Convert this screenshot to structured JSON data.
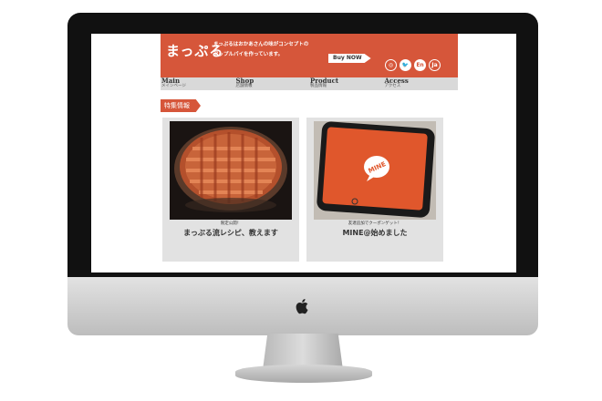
{
  "site": {
    "logo": "まっぷる",
    "tagline": "まっぷるはおかあさんの味がコンセプトの\nアップルパイを作っています。",
    "buy_label": "Buy NOW",
    "social": [
      {
        "icon": "instagram-icon",
        "label": "◎"
      },
      {
        "icon": "twitter-icon",
        "label": "🐦"
      },
      {
        "icon": "english-icon",
        "label": "En"
      },
      {
        "icon": "japanese-icon",
        "label": "Ja"
      }
    ],
    "nav": [
      {
        "en": "Main",
        "ja": "メインページ"
      },
      {
        "en": "Shop",
        "ja": "店舗情報"
      },
      {
        "en": "Product",
        "ja": "製品情報"
      },
      {
        "en": "Access",
        "ja": "アクセス"
      }
    ],
    "section_label": "特集情報",
    "cards": [
      {
        "small": "限定公開！",
        "title": "まっぷる流レシピ、教えます"
      },
      {
        "small": "友達追加でクーポンゲット！",
        "title": "MINE@始めました"
      }
    ],
    "app_logo_text": "MINE",
    "colors": {
      "brand": "#d6563a",
      "nav_bg": "#d9d9d9",
      "card_bg": "#e2e2e2"
    }
  }
}
